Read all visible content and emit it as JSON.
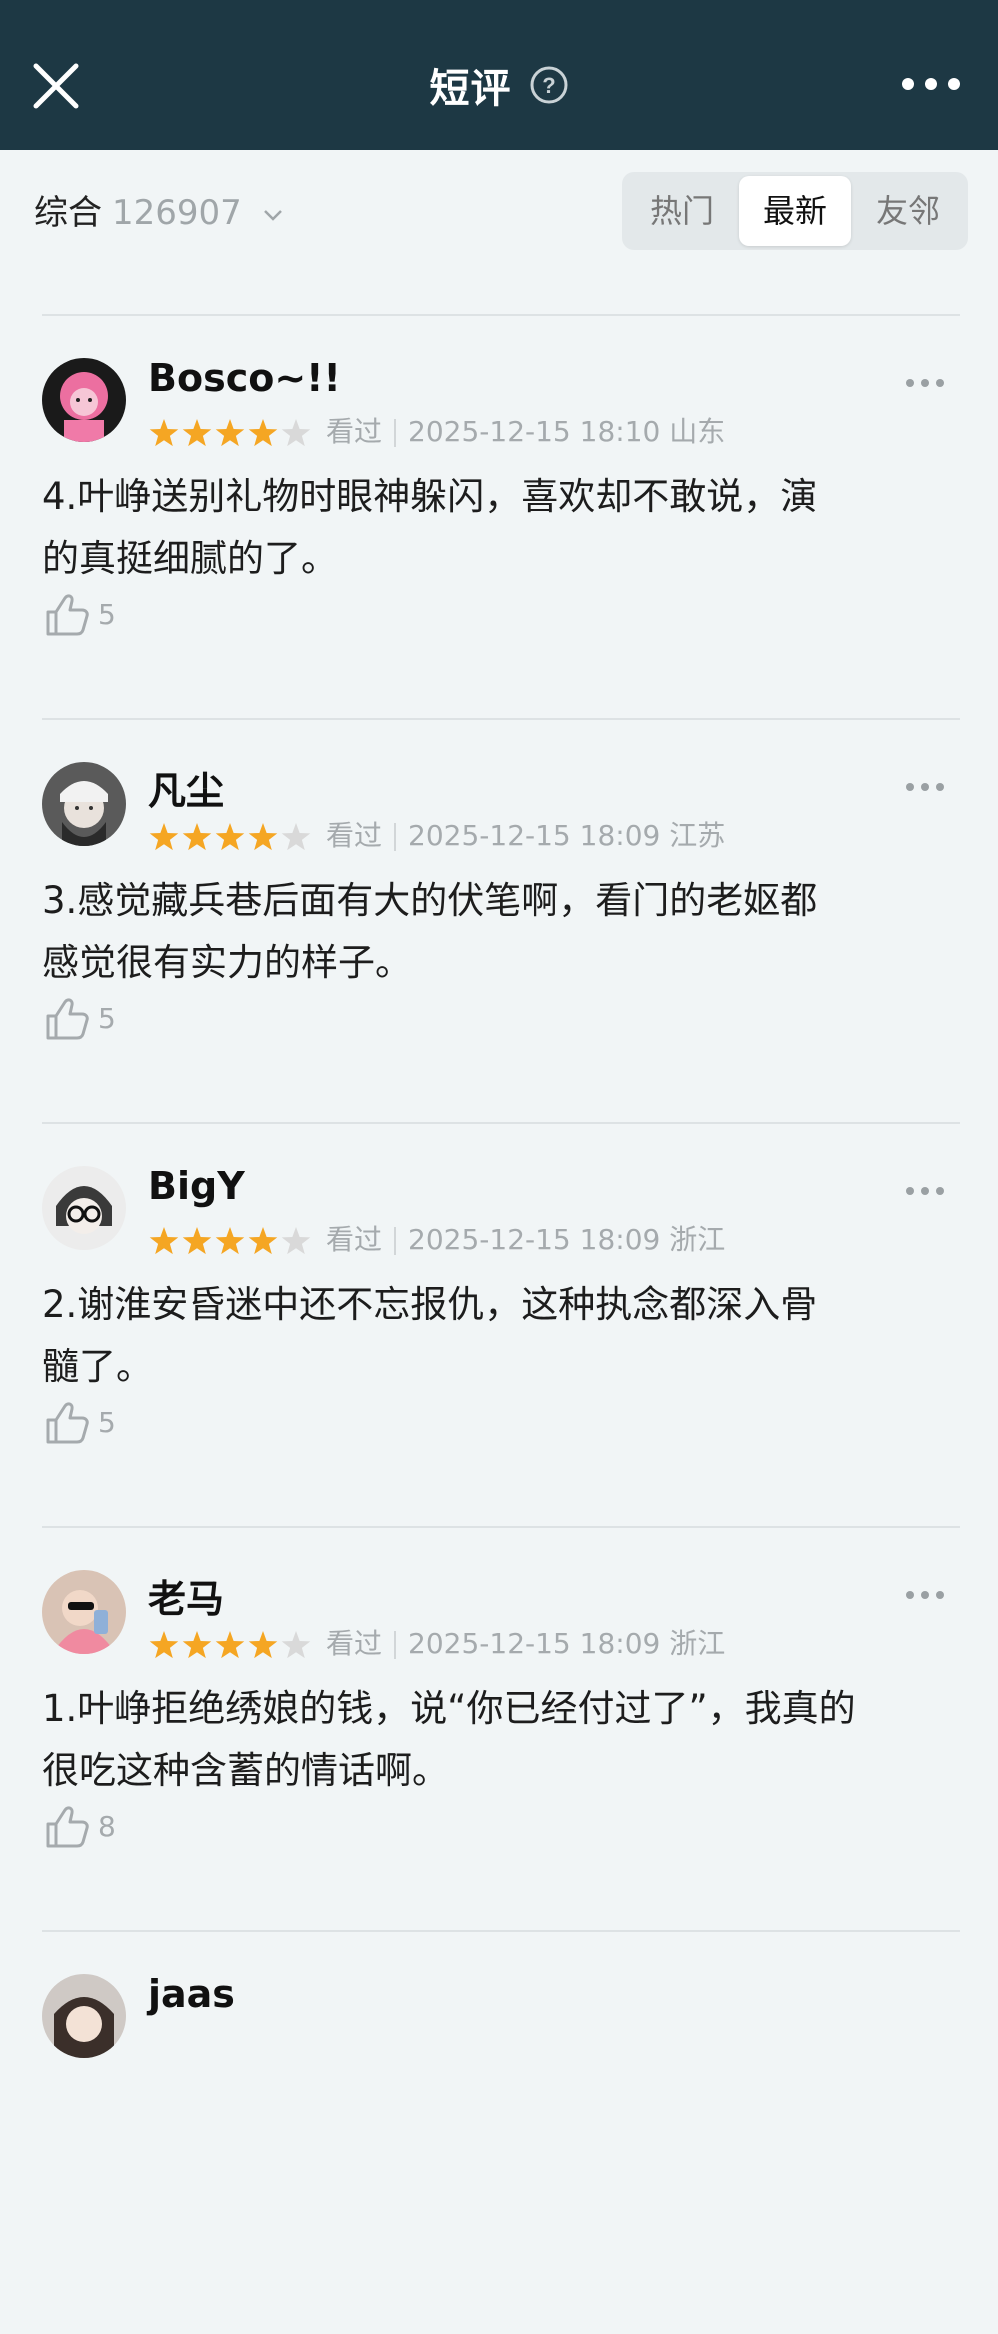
{
  "header": {
    "title": "短评",
    "close_icon": "close-icon",
    "help_icon": "help-circle-icon",
    "more_icon": "more-horizontal-icon"
  },
  "filter": {
    "sort_label": "综合",
    "sort_count": "126907",
    "tabs": [
      {
        "label": "热门"
      },
      {
        "label": "最新"
      },
      {
        "label": "友邻"
      }
    ],
    "active_tab": "最新"
  },
  "reviews": [
    {
      "user": "Bosco~!!",
      "rating": 4,
      "status": "看过",
      "time": "2025-12-15 18:10",
      "location": "山东",
      "lines": [
        "4.叶峥送别礼物时眼神躲闪，喜欢却不敢说，演",
        "的真挺细腻的了。"
      ],
      "likes": "5"
    },
    {
      "user": "凡尘",
      "rating": 4,
      "status": "看过",
      "time": "2025-12-15 18:09",
      "location": "江苏",
      "lines": [
        "3.感觉藏兵巷后面有大的伏笔啊，看门的老妪都",
        "感觉很有实力的样子。"
      ],
      "likes": "5"
    },
    {
      "user": "BigY",
      "rating": 4,
      "status": "看过",
      "time": "2025-12-15 18:09",
      "location": "浙江",
      "lines": [
        "2.谢淮安昏迷中还不忘报仇，这种执念都深入骨",
        "髓了。"
      ],
      "likes": "5"
    },
    {
      "user": "老马",
      "rating": 4,
      "status": "看过",
      "time": "2025-12-15 18:09",
      "location": "浙江",
      "lines": [
        "1.叶峥拒绝绣娘的钱，说“你已经付过了”，我真的",
        "很吃这种含蓄的情话啊。"
      ],
      "likes": "8"
    }
  ],
  "partial_user": "jaas",
  "colors": {
    "header_bg": "#1d3844",
    "star": "#f5a623",
    "star_empty": "#d9d9d9",
    "muted": "#a5aaad"
  }
}
